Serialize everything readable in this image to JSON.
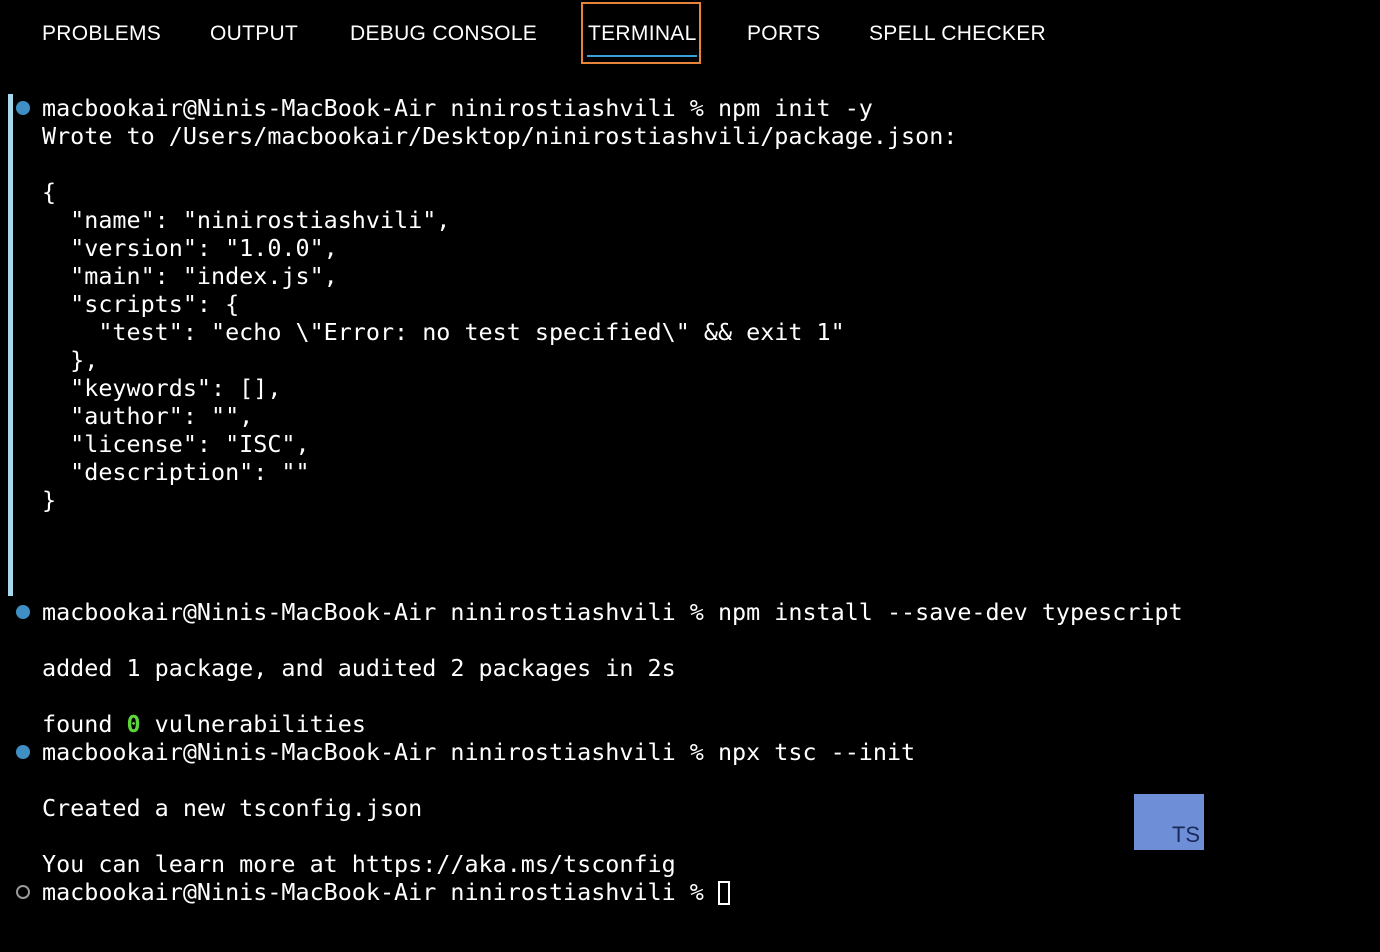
{
  "tabs": [
    {
      "label": "PROBLEMS",
      "active": false
    },
    {
      "label": "OUTPUT",
      "active": false
    },
    {
      "label": "DEBUG CONSOLE",
      "active": false
    },
    {
      "label": "TERMINAL",
      "active": true
    },
    {
      "label": "PORTS",
      "active": false
    },
    {
      "label": "SPELL CHECKER",
      "active": false
    }
  ],
  "colors": {
    "background": "#000000",
    "text": "#ffffff",
    "active_tab_border": "#e8843a",
    "active_tab_underline": "#3a9fd6",
    "command_marker": "#3f8fc4",
    "sidebar_bar": "#a8d8ee",
    "highlight_zero": "#5fd53d",
    "ts_badge_bg": "#6e8fd8"
  },
  "terminal": {
    "prompt": "macbookair@Ninis-MacBook-Air ninirostiashvili % ",
    "commands": [
      "npm init -y",
      "npm install --save-dev typescript",
      "npx tsc --init"
    ],
    "output_1": {
      "wrote": "Wrote to /Users/macbookair/Desktop/ninirostiashvili/package.json:",
      "json_lines": [
        "{",
        "  \"name\": \"ninirostiashvili\",",
        "  \"version\": \"1.0.0\",",
        "  \"main\": \"index.js\",",
        "  \"scripts\": {",
        "    \"test\": \"echo \\\"Error: no test specified\\\" && exit 1\"",
        "  },",
        "  \"keywords\": [],",
        "  \"author\": \"\",",
        "  \"license\": \"ISC\",",
        "  \"description\": \"\"",
        "}"
      ]
    },
    "output_2": {
      "added": "added 1 package, and audited 2 packages in 2s",
      "found_prefix": "found ",
      "found_count": "0",
      "found_suffix": " vulnerabilities"
    },
    "output_3": {
      "created": "Created a new tsconfig.json",
      "learn": "You can learn more at https://aka.ms/tsconfig"
    }
  },
  "ts_badge": {
    "label": "TS"
  }
}
